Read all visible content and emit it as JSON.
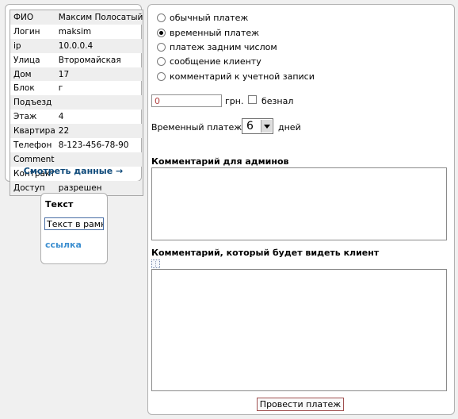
{
  "user_info": {
    "rows": [
      {
        "label": "ФИО",
        "value": "Максим Полосатый"
      },
      {
        "label": "Логин",
        "value": "maksim"
      },
      {
        "label": "ip",
        "value": "10.0.0.4"
      },
      {
        "label": "Улица",
        "value": "Второмайская"
      },
      {
        "label": "Дом",
        "value": "17"
      },
      {
        "label": "Блок",
        "value": "г"
      },
      {
        "label": "Подъезд",
        "value": ""
      },
      {
        "label": "Этаж",
        "value": "4"
      },
      {
        "label": "Квартира",
        "value": "22"
      },
      {
        "label": "Телефон",
        "value": "8-123-456-78-90"
      },
      {
        "label": "Comment",
        "value": ""
      },
      {
        "label": "Контракт",
        "value": ""
      },
      {
        "label": "Доступ",
        "value": "разрешен"
      }
    ],
    "view_link": "Смотреть данные →"
  },
  "text_box": {
    "title": "Текст",
    "framed_text": "Текст в рамке",
    "link": "ссылка"
  },
  "payment": {
    "types": [
      {
        "label": "обычный платеж",
        "selected": false
      },
      {
        "label": "временный платеж",
        "selected": true
      },
      {
        "label": "платеж задним числом",
        "selected": false
      },
      {
        "label": "сообщение клиенту",
        "selected": false
      },
      {
        "label": "комментарий к учетной записи",
        "selected": false
      }
    ],
    "amount_value": "0",
    "currency": "грн.",
    "cashless_label": "безнал",
    "cashless_checked": false,
    "temp_label": "Временный платеж на",
    "days_value": "6",
    "days_word": "дней",
    "admin_comment_label": "Комментарий для админов",
    "admin_comment_value": "",
    "client_comment_label": "Комментарий, который будет видеть клиент",
    "client_comment_value": "",
    "submit_label": "Провести платеж"
  }
}
